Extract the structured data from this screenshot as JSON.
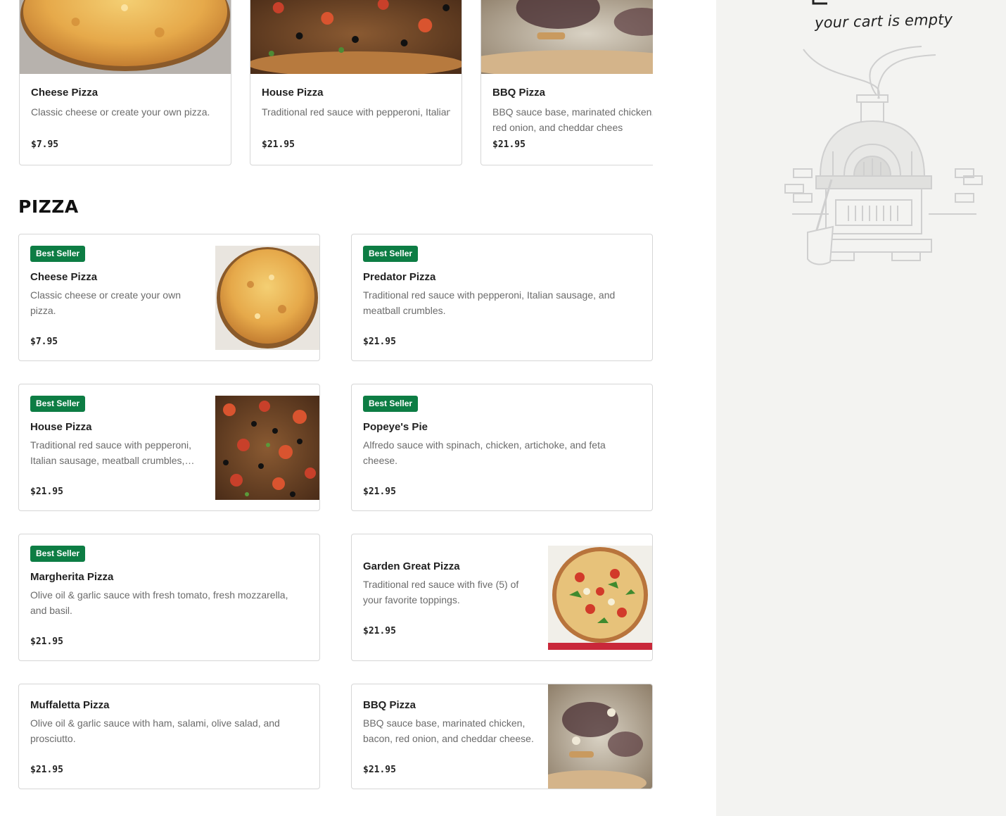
{
  "featured": [
    {
      "name": "Cheese Pizza",
      "description": "Classic cheese or create your own pizza.",
      "price": "$7.95"
    },
    {
      "name": "House Pizza",
      "description": "Traditional red sauce with pepperoni, Italian sausage, meatball crumbles, onio…",
      "price": "$21.95"
    },
    {
      "name": "BBQ Pizza",
      "description": "BBQ sauce base, marinated chicken, bacon, red onion, and cheddar chees",
      "price": "$21.95"
    }
  ],
  "section": {
    "title": "PIZZA"
  },
  "items": [
    {
      "badge": "Best Seller",
      "name": "Cheese Pizza",
      "description": "Classic cheese or create your own pizza.",
      "price": "$7.95"
    },
    {
      "badge": "Best Seller",
      "name": "Predator Pizza",
      "description": "Traditional red sauce with pepperoni, Italian sausage, and meatball crumbles.",
      "price": "$21.95"
    },
    {
      "badge": "Best Seller",
      "name": "House Pizza",
      "description": "Traditional red sauce with pepperoni, Italian sausage, meatball crumbles,…",
      "price": "$21.95"
    },
    {
      "badge": "Best Seller",
      "name": "Popeye's Pie",
      "description": "Alfredo sauce with spinach, chicken, artichoke, and feta cheese.",
      "price": "$21.95"
    },
    {
      "badge": "Best Seller",
      "name": "Margherita Pizza",
      "description": "Olive oil & garlic sauce with fresh tomato, fresh mozzarella, and basil.",
      "price": "$21.95"
    },
    {
      "name": "Garden Great Pizza",
      "description": "Traditional red sauce with five (5) of your favorite toppings.",
      "price": "$21.95"
    },
    {
      "name": "Muffaletta Pizza",
      "description": "Olive oil & garlic sauce with ham, salami, olive salad, and prosciutto.",
      "price": "$21.95"
    },
    {
      "name": "BBQ Pizza",
      "description": "BBQ sauce base, marinated chicken, bacon, red onion, and cheddar cheese.",
      "price": "$21.95"
    }
  ],
  "cart": {
    "empty_message": "your cart is empty",
    "illustration": "pizza-oven-illustration"
  },
  "colors": {
    "badge": "#0d7d44",
    "sidebar": "#f3f3f1",
    "border": "#d6d6d6",
    "muted_text": "#6b6b6b"
  }
}
